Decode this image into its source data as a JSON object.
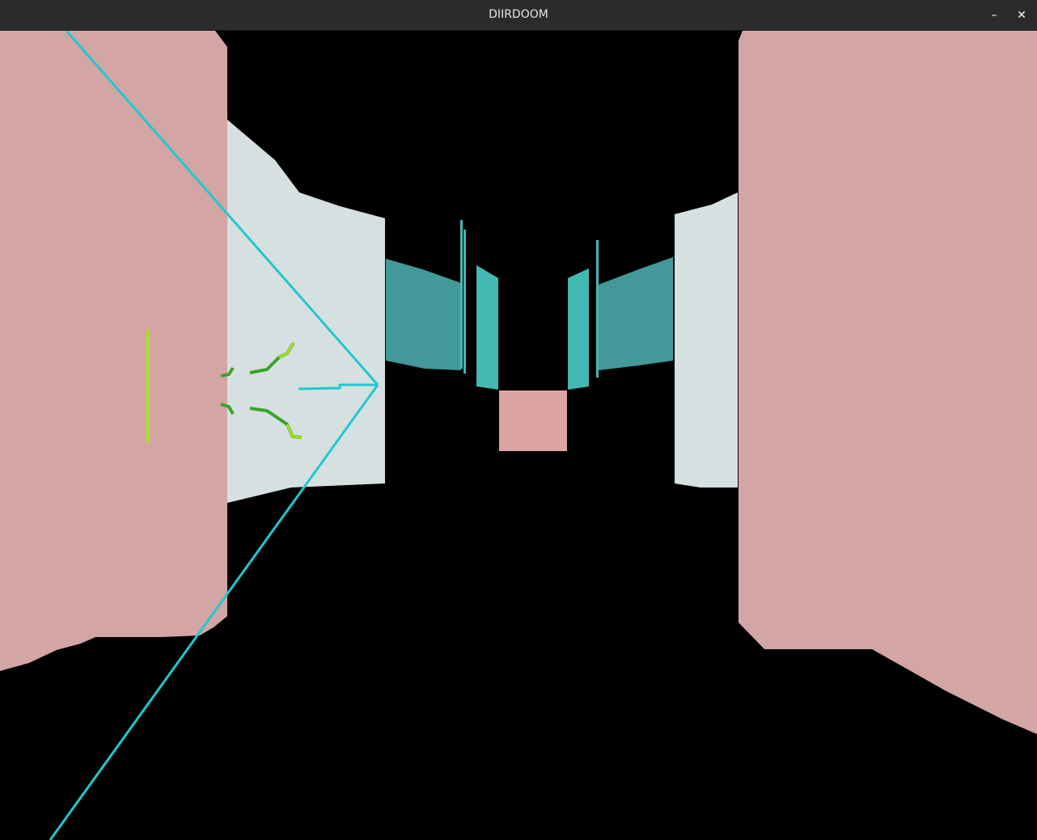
{
  "window": {
    "title": "DIIRDOOM"
  },
  "titlebar_buttons": {
    "minimize_glyph": "–",
    "close_glyph": "✕"
  },
  "colors": {
    "background": "#000000",
    "near_wall": "#d4a5a5",
    "mid_wall": "#d7e0e0",
    "far_wall_teal": "#43999a",
    "far_wall_teal_light": "#44b8b3",
    "end_block": "#dea4a4",
    "laser": "#20c8d0",
    "weapon_green_light": "#a6e21e",
    "weapon_green_dark": "#3aa32a"
  },
  "icons": {
    "minimize": "minimize-icon",
    "close": "close-icon"
  }
}
